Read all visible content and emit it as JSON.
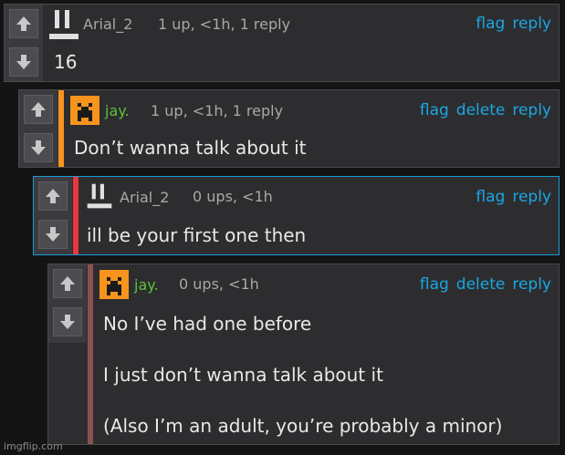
{
  "comments": [
    {
      "username": "Arial_2",
      "meta": "1 up, <1h, 1 reply",
      "actions": {
        "flag": "flag",
        "reply": "reply"
      },
      "lines": [
        "16"
      ]
    },
    {
      "username": "jay.",
      "meta": "1 up, <1h, 1 reply",
      "actions": {
        "flag": "flag",
        "delete": "delete",
        "reply": "reply"
      },
      "lines": [
        "Don’t wanna talk about it"
      ]
    },
    {
      "username": "Arial_2",
      "meta": "0 ups, <1h",
      "actions": {
        "flag": "flag",
        "reply": "reply"
      },
      "lines": [
        "ill be your first one then"
      ]
    },
    {
      "username": "jay.",
      "meta": "0 ups, <1h",
      "actions": {
        "flag": "flag",
        "delete": "delete",
        "reply": "reply"
      },
      "lines": [
        "No I’ve had one before",
        "I just don’t wanna talk about it",
        "(Also I’m an adult, you’re probably a minor)"
      ]
    }
  ],
  "colors": {
    "accent_orange": "#f7941d",
    "accent_red": "#e8363b",
    "accent_muted_red": "#8a5252",
    "link": "#1aa7e2",
    "username_green": "#5cc23a",
    "highlight_border": "#1a9ad6"
  },
  "icons": {
    "upvote": "arrow-up-icon",
    "downvote": "arrow-down-icon",
    "arial_avatar": "pause-bar-icon",
    "jay_avatar": "orange-pixel-face-icon"
  },
  "watermark": "imgflip.com"
}
